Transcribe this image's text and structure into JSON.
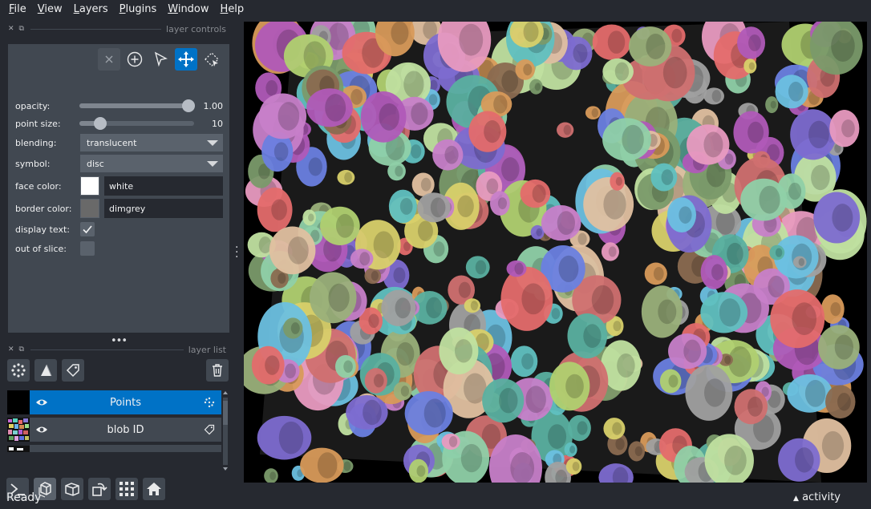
{
  "menubar": {
    "items": [
      {
        "label": "File",
        "underline": "F",
        "rest": "ile"
      },
      {
        "label": "View",
        "underline": "V",
        "rest": "iew"
      },
      {
        "label": "Layers",
        "underline": "L",
        "rest": "ayers"
      },
      {
        "label": "Plugins",
        "underline": "P",
        "rest": "lugins"
      },
      {
        "label": "Window",
        "underline": "W",
        "rest": "indow"
      },
      {
        "label": "Help",
        "underline": "H",
        "rest": "elp"
      }
    ]
  },
  "layer_controls": {
    "title": "layer controls",
    "opacity": {
      "label": "opacity:",
      "value": "1.00",
      "fraction": 1.0
    },
    "point_size": {
      "label": "point size:",
      "value": "10",
      "fraction": 0.14
    },
    "blending": {
      "label": "blending:",
      "value": "translucent"
    },
    "symbol": {
      "label": "symbol:",
      "value": "disc"
    },
    "face_color": {
      "label": "face color:",
      "value": "white",
      "swatch": "#ffffff"
    },
    "border_color": {
      "label": "border color:",
      "value": "dimgrey",
      "swatch": "#696969"
    },
    "display_text": {
      "label": "display text:",
      "checked": true
    },
    "out_of_slice": {
      "label": "out of slice:",
      "checked": false
    }
  },
  "layer_list": {
    "title": "layer list",
    "layers": [
      {
        "name": "Points",
        "selected": true
      },
      {
        "name": "blob ID",
        "selected": false
      }
    ]
  },
  "status": {
    "text": "Ready",
    "activity": "activity"
  },
  "colors": {
    "accent": "#0072c6",
    "background": "#262930",
    "panel": "#414851"
  }
}
